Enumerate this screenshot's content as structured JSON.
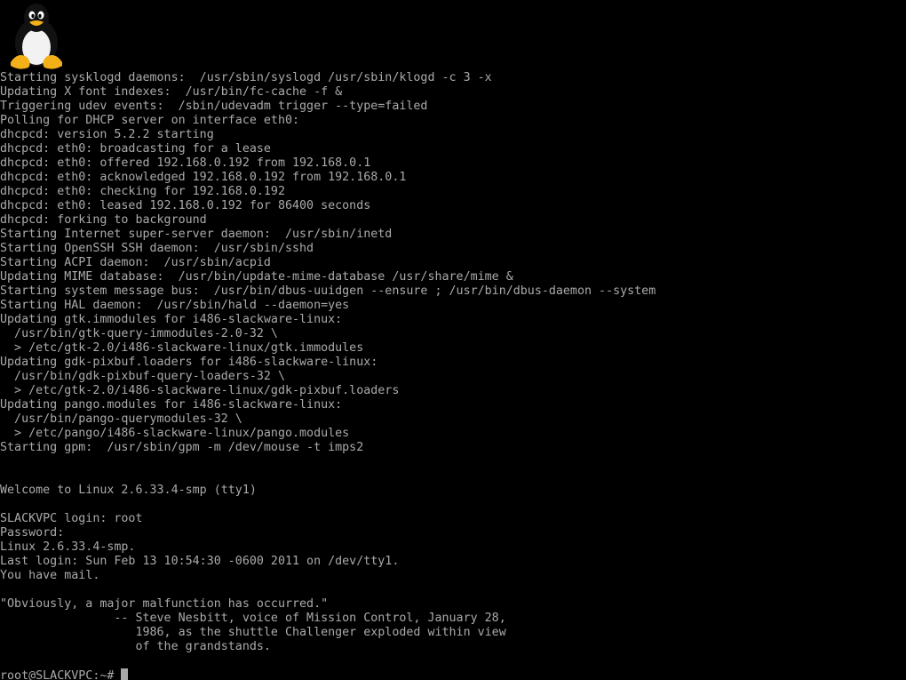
{
  "colors": {
    "background": "#000000",
    "text": "#aaaaaa"
  },
  "logo": {
    "icon": "tux-penguin-icon"
  },
  "console": {
    "lines": [
      "Starting sysklogd daemons:  /usr/sbin/syslogd /usr/sbin/klogd -c 3 -x",
      "Updating X font indexes:  /usr/bin/fc-cache -f &",
      "Triggering udev events:  /sbin/udevadm trigger --type=failed",
      "Polling for DHCP server on interface eth0:",
      "dhcpcd: version 5.2.2 starting",
      "dhcpcd: eth0: broadcasting for a lease",
      "dhcpcd: eth0: offered 192.168.0.192 from 192.168.0.1",
      "dhcpcd: eth0: acknowledged 192.168.0.192 from 192.168.0.1",
      "dhcpcd: eth0: checking for 192.168.0.192",
      "dhcpcd: eth0: leased 192.168.0.192 for 86400 seconds",
      "dhcpcd: forking to background",
      "Starting Internet super-server daemon:  /usr/sbin/inetd",
      "Starting OpenSSH SSH daemon:  /usr/sbin/sshd",
      "Starting ACPI daemon:  /usr/sbin/acpid",
      "Updating MIME database:  /usr/bin/update-mime-database /usr/share/mime &",
      "Starting system message bus:  /usr/bin/dbus-uuidgen --ensure ; /usr/bin/dbus-daemon --system",
      "Starting HAL daemon:  /usr/sbin/hald --daemon=yes",
      "Updating gtk.immodules for i486-slackware-linux:",
      "  /usr/bin/gtk-query-immodules-2.0-32 \\",
      "  > /etc/gtk-2.0/i486-slackware-linux/gtk.immodules",
      "Updating gdk-pixbuf.loaders for i486-slackware-linux:",
      "  /usr/bin/gdk-pixbuf-query-loaders-32 \\",
      "  > /etc/gtk-2.0/i486-slackware-linux/gdk-pixbuf.loaders",
      "Updating pango.modules for i486-slackware-linux:",
      "  /usr/bin/pango-querymodules-32 \\",
      "  > /etc/pango/i486-slackware-linux/pango.modules",
      "Starting gpm:  /usr/sbin/gpm -m /dev/mouse -t imps2",
      "",
      "",
      "Welcome to Linux 2.6.33.4-smp (tty1)",
      "",
      "SLACKVPC login: root",
      "Password:",
      "Linux 2.6.33.4-smp.",
      "Last login: Sun Feb 13 10:54:30 -0600 2011 on /dev/tty1.",
      "You have mail.",
      "",
      "\"Obviously, a major malfunction has occurred.\"",
      "                -- Steve Nesbitt, voice of Mission Control, January 28,",
      "                   1986, as the shuttle Challenger exploded within view",
      "                   of the grandstands.",
      ""
    ],
    "prompt": "root@SLACKVPC:~# "
  }
}
